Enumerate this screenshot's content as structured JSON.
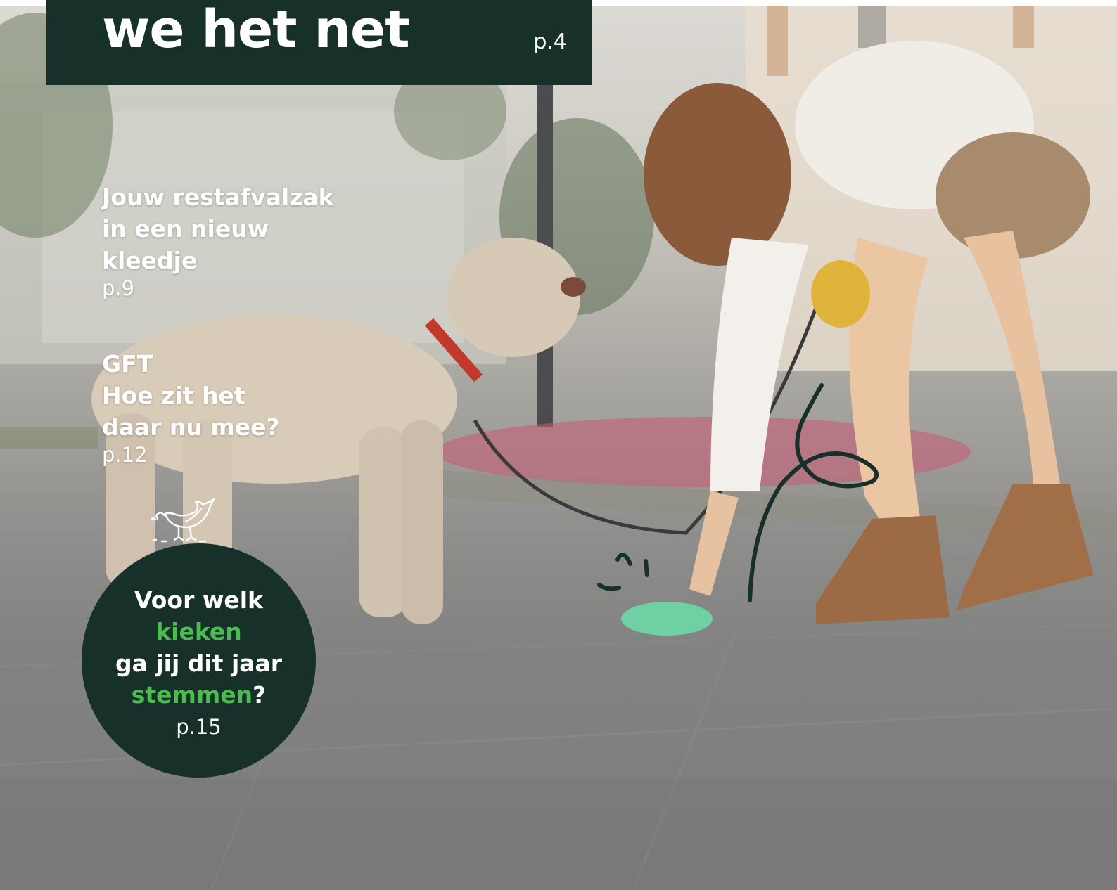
{
  "headline": {
    "title": "we het net",
    "page": "p.4"
  },
  "teasers": [
    {
      "title": "Jouw restafvalzak\nin een nieuw\nkleedje",
      "page": "p.9"
    },
    {
      "title": "GFT\nHoe zit het\ndaar nu mee?",
      "page": "p.12"
    }
  ],
  "badge": {
    "line1": "Voor welk",
    "line2_green": "kieken",
    "line3": "ga jij dit jaar",
    "line4_green": "stemmen",
    "line4_tail": "?",
    "page": "p.15"
  },
  "photo": {
    "icon": "chicken-icon",
    "doodle": "swoosh-doodle-icon"
  },
  "colors": {
    "dark_green": "#17302a",
    "accent_green": "#4bbd4f",
    "text_white": "#ffffff"
  }
}
